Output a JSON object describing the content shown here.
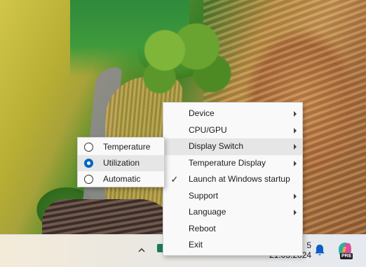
{
  "taskbar": {
    "clock_time": "5",
    "clock_date": "21.03.2024",
    "copilot_badge": "PRE"
  },
  "context_menu": {
    "items": [
      {
        "label": "Device",
        "has_submenu": true
      },
      {
        "label": "CPU/GPU",
        "has_submenu": true
      },
      {
        "label": "Display Switch",
        "has_submenu": true,
        "highlighted": true
      },
      {
        "label": "Temperature Display",
        "has_submenu": true
      },
      {
        "label": "Launch at Windows startup",
        "checked": true
      },
      {
        "label": "Support",
        "has_submenu": true
      },
      {
        "label": "Language",
        "has_submenu": true
      },
      {
        "label": "Reboot"
      },
      {
        "label": "Exit"
      }
    ]
  },
  "display_switch_submenu": {
    "items": [
      {
        "label": "Temperature",
        "selected": false
      },
      {
        "label": "Utilization",
        "selected": true
      },
      {
        "label": "Automatic",
        "selected": false
      }
    ]
  },
  "colors": {
    "accent": "#0067c0",
    "menu_bg": "#f9f9f9",
    "highlight": "#e6e6e6"
  }
}
